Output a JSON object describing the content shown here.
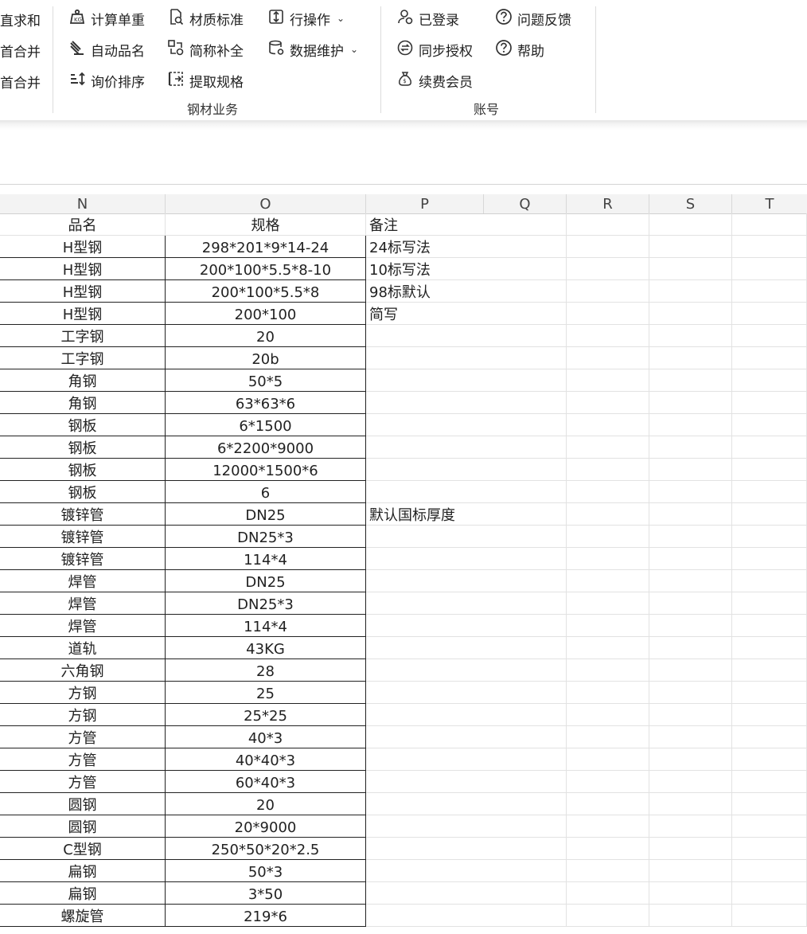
{
  "ribbon": {
    "left_cut": [
      "直求和",
      "首合并",
      "首合并"
    ],
    "steel_group": {
      "label": "钢材业务",
      "buttons": [
        {
          "label": "计算单重",
          "icon": "weight-calc-icon"
        },
        {
          "label": "自动品名",
          "icon": "steel-bars-icon"
        },
        {
          "label": "询价排序",
          "icon": "sort-icon"
        },
        {
          "label": "材质标准",
          "icon": "search-doc-icon"
        },
        {
          "label": "简称补全",
          "icon": "shapes-icon"
        },
        {
          "label": "提取规格",
          "icon": "extract-icon"
        },
        {
          "label": "行操作",
          "icon": "row-ops-icon",
          "dropdown": true
        },
        {
          "label": "数据维护",
          "icon": "database-gear-icon",
          "dropdown": true
        }
      ]
    },
    "account_group": {
      "label": "账号",
      "buttons": [
        {
          "label": "已登录",
          "icon": "user-icon"
        },
        {
          "label": "同步授权",
          "icon": "sync-icon"
        },
        {
          "label": "续费会员",
          "icon": "money-bag-icon"
        },
        {
          "label": "问题反馈",
          "icon": "question-icon"
        },
        {
          "label": "帮助",
          "icon": "help-icon"
        }
      ]
    }
  },
  "sheet": {
    "columns": [
      "N",
      "O",
      "P",
      "Q",
      "R",
      "S",
      "T"
    ],
    "rows": [
      [
        "品名",
        "规格",
        "备注"
      ],
      [
        "H型钢",
        "298*201*9*14-24",
        "24标写法"
      ],
      [
        "H型钢",
        "200*100*5.5*8-10",
        "10标写法"
      ],
      [
        "H型钢",
        "200*100*5.5*8",
        "98标默认"
      ],
      [
        "H型钢",
        "200*100",
        "简写"
      ],
      [
        "工字钢",
        "20",
        ""
      ],
      [
        "工字钢",
        "20b",
        ""
      ],
      [
        "角钢",
        "50*5",
        ""
      ],
      [
        "角钢",
        "63*63*6",
        ""
      ],
      [
        "钢板",
        "6*1500",
        ""
      ],
      [
        "钢板",
        "6*2200*9000",
        ""
      ],
      [
        "钢板",
        "12000*1500*6",
        ""
      ],
      [
        "钢板",
        "6",
        ""
      ],
      [
        "镀锌管",
        "DN25",
        "默认国标厚度"
      ],
      [
        "镀锌管",
        "DN25*3",
        ""
      ],
      [
        "镀锌管",
        "114*4",
        ""
      ],
      [
        "焊管",
        "DN25",
        ""
      ],
      [
        "焊管",
        "DN25*3",
        ""
      ],
      [
        "焊管",
        "114*4",
        ""
      ],
      [
        "道轨",
        "43KG",
        ""
      ],
      [
        "六角钢",
        "28",
        ""
      ],
      [
        "方钢",
        "25",
        ""
      ],
      [
        "方钢",
        "25*25",
        ""
      ],
      [
        "方管",
        "40*3",
        ""
      ],
      [
        "方管",
        "40*40*3",
        ""
      ],
      [
        "方管",
        "60*40*3",
        ""
      ],
      [
        "圆钢",
        "20",
        ""
      ],
      [
        "圆钢",
        "20*9000",
        ""
      ],
      [
        "C型钢",
        "250*50*20*2.5",
        ""
      ],
      [
        "扁钢",
        "50*3",
        ""
      ],
      [
        "扁钢",
        "3*50",
        ""
      ],
      [
        "螺旋管",
        "219*6",
        ""
      ]
    ]
  },
  "colors": {
    "border_dark": "#222222",
    "grid_line": "#e2e2e2",
    "header_bg": "#f3f3f3"
  }
}
